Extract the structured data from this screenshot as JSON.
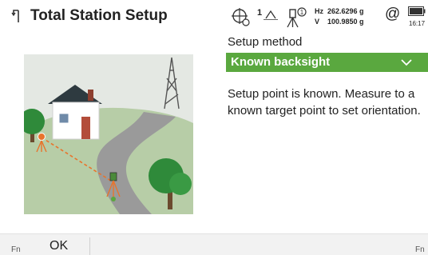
{
  "header": {
    "title": "Total Station Setup",
    "hz": {
      "label": "Hz",
      "value": "262.6296 g"
    },
    "v": {
      "label": "V",
      "value": "100.9850 g"
    },
    "prism_count": "1",
    "at_symbol": "@",
    "time": "16:17",
    "icons": [
      "back-arrow-icon",
      "crosshair-icon",
      "prism-icon",
      "instrument-icon",
      "battery-icon"
    ]
  },
  "setup": {
    "label": "Setup method",
    "selected": "Known backsight",
    "description": "Setup point is known. Measure to a known target point to set orientation."
  },
  "softkeys": {
    "fn_left": "Fn",
    "ok": "OK",
    "fn_right": "Fn"
  },
  "colors": {
    "accent": "#5aa83f",
    "line": "#e8742c"
  }
}
